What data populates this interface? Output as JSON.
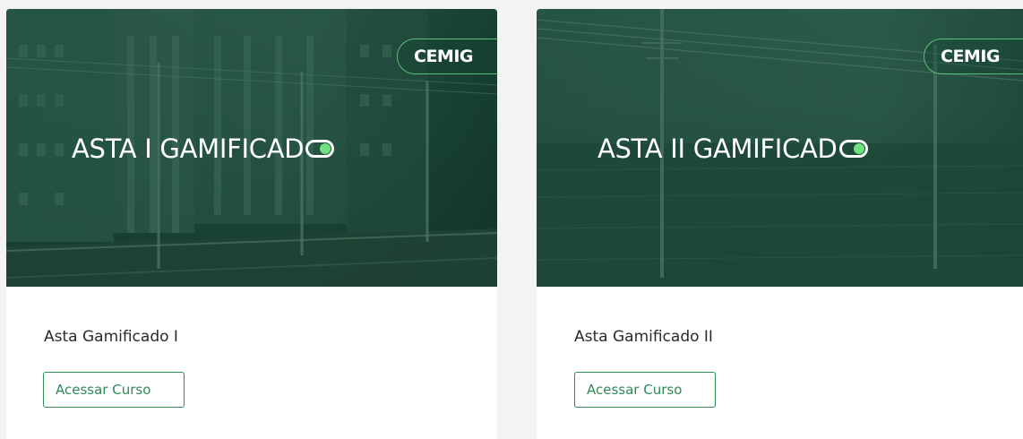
{
  "courses": [
    {
      "banner_logo": "CEMIG",
      "banner_title": "ASTA I GAMIFICAD",
      "title": "Asta Gamificado I",
      "button_label": "Acessar Curso"
    },
    {
      "banner_logo": "CEMIG",
      "banner_title": "ASTA II GAMIFICAD",
      "title": "Asta Gamificado II",
      "button_label": "Acessar Curso"
    }
  ],
  "colors": {
    "accent": "#2e8a57",
    "banner_green": "#24503f",
    "toggle_knob": "#6ee37f",
    "badge_border": "#58c07a"
  },
  "icons": {
    "title_suffix": "toggle-switch-icon"
  }
}
